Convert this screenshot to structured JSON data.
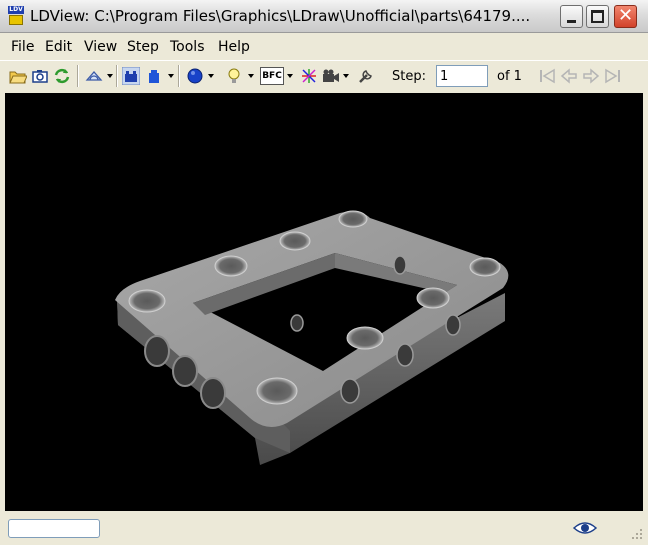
{
  "window": {
    "title": "LDView: C:\\Program Files\\Graphics\\LDraw\\Unofficial\\parts\\64179....",
    "icon_label": "LDV"
  },
  "menu": [
    "File",
    "Edit",
    "View",
    "Step",
    "Tools",
    "Help"
  ],
  "toolbar": {
    "icons": [
      "open-folder-icon",
      "screenshot-camera-icon",
      "reload-icon",
      "view-angle-icon",
      "brick-studs-icon",
      "brick-color-icon",
      "fill-sphere-icon",
      "lightbulb-icon",
      "bfc-icon",
      "axes-star-icon",
      "camera-icon",
      "wrench-icon"
    ],
    "bfc_label": "BFC",
    "step_label": "Step:",
    "step_value": "1",
    "step_of": "of 1",
    "nav_icons": [
      "first-step-icon",
      "prev-step-icon",
      "next-step-icon",
      "last-step-icon"
    ]
  },
  "status": {
    "field_value": "",
    "icon": "eye-icon"
  },
  "colors": {
    "viewport_bg": "#000000",
    "part_gray": "#8c8c8c",
    "window_bg": "#ece9d8",
    "close_red": "#d2422a"
  }
}
